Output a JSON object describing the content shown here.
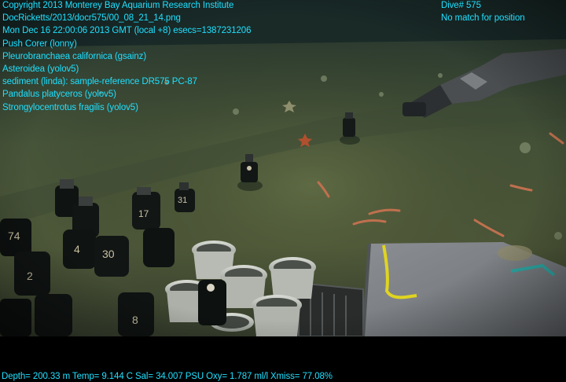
{
  "overlay": {
    "left_lines": [
      "Copyright 2013 Monterey Bay Aquarium Research Institute",
      "DocRicketts/2013/docr575/00_08_21_14.png",
      "Mon Dec 16 22:00:06 2013 GMT (local +8)  esecs=1387231206",
      "Push Corer (lonny)",
      "Pleurobranchaea californica (gsainz)",
      "Asteroidea (yolov5)",
      "sediment (linda): sample-reference DR575 PC-87",
      "Pandalus platyceros (yolov5)",
      "Strongylocentrotus fragilis (yolov5)"
    ],
    "right_lines": [
      "Dive# 575",
      "No match for position"
    ],
    "sensor_line": "Depth= 200.33 m  Temp= 9.144 C  Sal= 34.007 PSU  Oxy= 1.787 ml/l  Xmiss= 77.08%",
    "text_color": "#1fe0ff"
  },
  "scene": {
    "description_colors": {
      "seafloor": "#4a5638",
      "water": "#142a2a",
      "shadow": "#1c241a"
    },
    "core_tube_numbers": [
      "74",
      "2",
      "4",
      "30",
      "17",
      "31",
      "8"
    ]
  }
}
